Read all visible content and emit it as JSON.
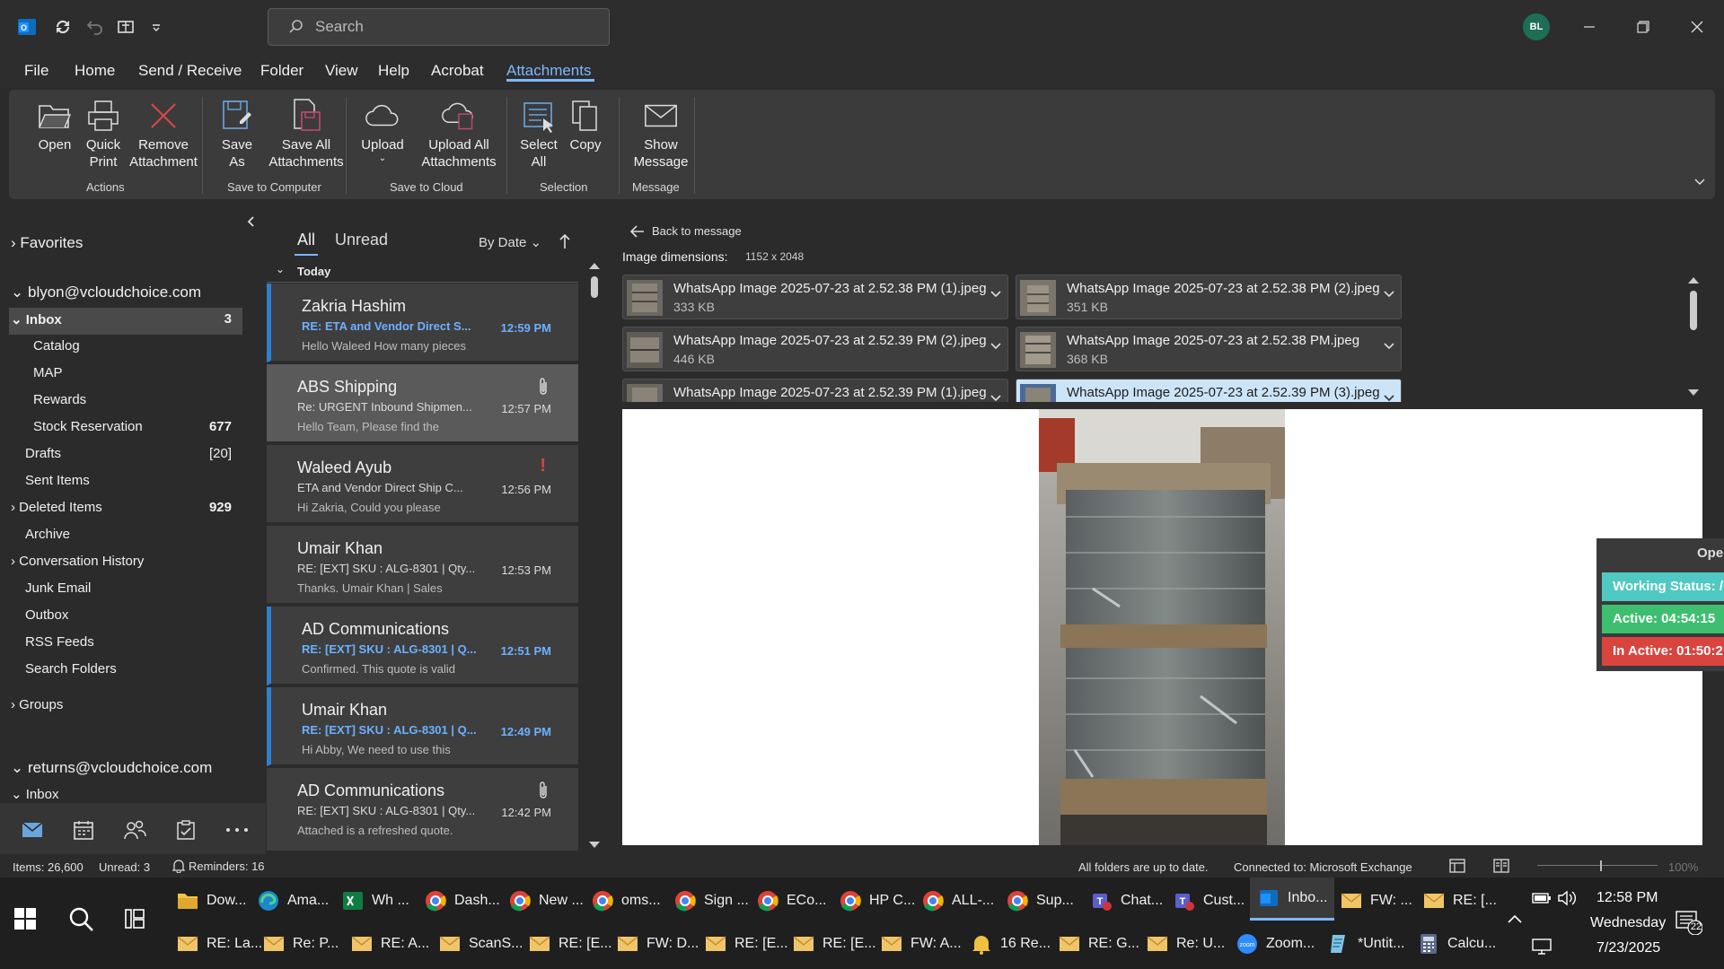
{
  "titlebar": {
    "search_placeholder": "Search",
    "avatar_initials": "BL"
  },
  "menu": {
    "items": [
      "File",
      "Home",
      "Send / Receive",
      "Folder",
      "View",
      "Help",
      "Acrobat",
      "Attachments"
    ],
    "active": "Attachments"
  },
  "ribbon": {
    "buttons": {
      "open": "Open",
      "quick_print_1": "Quick",
      "quick_print_2": "Print",
      "remove_1": "Remove",
      "remove_2": "Attachment",
      "save_as_1": "Save",
      "save_as_2": "As",
      "save_all_1": "Save All",
      "save_all_2": "Attachments",
      "upload": "Upload",
      "upload_all_1": "Upload All",
      "upload_all_2": "Attachments",
      "select_all_1": "Select",
      "select_all_2": "All",
      "copy": "Copy",
      "show_message_1": "Show",
      "show_message_2": "Message"
    },
    "groups": {
      "actions": "Actions",
      "save_to_computer": "Save to Computer",
      "save_to_cloud": "Save to Cloud",
      "selection": "Selection",
      "message": "Message"
    }
  },
  "folders": {
    "favorites": "Favorites",
    "account1": "blyon@vcloudchoice.com",
    "inbox": "Inbox",
    "inbox_count": "3",
    "catalog": "Catalog",
    "map": "MAP",
    "rewards": "Rewards",
    "stock_reservation": "Stock Reservation",
    "stock_reservation_count": "677",
    "drafts": "Drafts",
    "drafts_count": "[20]",
    "sent_items": "Sent Items",
    "deleted_items": "Deleted Items",
    "deleted_items_count": "929",
    "archive": "Archive",
    "conversation_history": "Conversation History",
    "junk_email": "Junk Email",
    "outbox": "Outbox",
    "rss_feeds": "RSS Feeds",
    "search_folders": "Search Folders",
    "groups": "Groups",
    "account2": "returns@vcloudchoice.com",
    "inbox2": "Inbox"
  },
  "msglist": {
    "filter_all": "All",
    "filter_unread": "Unread",
    "sort": "By Date",
    "group_today": "Today",
    "messages": [
      {
        "sender": "Zakria Hashim",
        "subject": "RE: ETA and Vendor Direct S...",
        "time": "12:59 PM",
        "preview": "Hello Waleed  How many pieces"
      },
      {
        "sender": "ABS Shipping",
        "subject": "Re: URGENT Inbound Shipmen...",
        "time": "12:57 PM",
        "preview": "Hello Team,  Please find the"
      },
      {
        "sender": "Waleed Ayub",
        "subject": "ETA and Vendor Direct Ship C...",
        "time": "12:56 PM",
        "preview": "Hi Zakria,  Could you please"
      },
      {
        "sender": "Umair Khan",
        "subject": "RE: [EXT] SKU : ALG-8301 | Qty...",
        "time": "12:53 PM",
        "preview": "Thanks.  Umair Khan | Sales"
      },
      {
        "sender": "AD Communications",
        "subject": "RE: [EXT] SKU : ALG-8301 | Q...",
        "time": "12:51 PM",
        "preview": "Confirmed. This quote is valid"
      },
      {
        "sender": "Umair Khan",
        "subject": "RE: [EXT] SKU : ALG-8301 | Q...",
        "time": "12:49 PM",
        "preview": "Hi Abby,  We need to use this"
      },
      {
        "sender": "AD Communications",
        "subject": "RE: [EXT] SKU : ALG-8301 | Qty...",
        "time": "12:42 PM",
        "preview": "Attached is a refreshed quote."
      }
    ]
  },
  "reading": {
    "back": "Back to message",
    "dimensions_label": "Image dimensions:",
    "dimensions_value": "1152 x 2048",
    "attachments": [
      {
        "name": "WhatsApp Image 2025-07-23 at 2.52.38 PM (1).jpeg",
        "size": "333 KB"
      },
      {
        "name": "WhatsApp Image 2025-07-23 at 2.52.38 PM (2).jpeg",
        "size": "351 KB"
      },
      {
        "name": "WhatsApp Image 2025-07-23 at 2.52.39 PM (2).jpeg",
        "size": "446 KB"
      },
      {
        "name": "WhatsApp Image 2025-07-23 at 2.52.38 PM.jpeg",
        "size": "368 KB"
      },
      {
        "name": "WhatsApp Image 2025-07-23 at 2.52.39 PM (1).jpeg",
        "size": ""
      },
      {
        "name": "WhatsApp Image 2025-07-23 at 2.52.39 PM (3).jpeg",
        "size": ""
      }
    ]
  },
  "widget": {
    "header": "Ope",
    "working": "Working Status: /",
    "active": "Active: 04:54:15",
    "inactive": "In Active: 01:50:2"
  },
  "status": {
    "items": "Items: 26,600",
    "unread": "Unread: 3",
    "reminders": "Reminders: 16",
    "uptodate": "All folders are up to date.",
    "connected": "Connected to: Microsoft Exchange",
    "zoom": "100%"
  },
  "taskbar": {
    "row1": [
      "Dow...",
      "Ama...",
      "Wh ...",
      "Dash...",
      "New ...",
      "oms...",
      "Sign ...",
      "ECo...",
      "HP C...",
      "ALL-...",
      "Sup...",
      "Chat...",
      "Cust...",
      "Inbo...",
      "FW: ...",
      "RE: [..."
    ],
    "row2": [
      "RE: La...",
      "Re: P...",
      "RE: A...",
      "ScanS...",
      "RE: [E...",
      "FW: D...",
      "RE: [E...",
      "RE: [E...",
      "FW: A...",
      "16 Re...",
      "RE: G...",
      "Re: U...",
      "Zoom...",
      "*Untit...",
      "Calcu..."
    ],
    "time": "12:58 PM",
    "day": "Wednesday",
    "date": "7/23/2025",
    "notif_count": "22"
  },
  "colors": {
    "accent": "#7db7ff",
    "unread_blue": "#2f7fcf",
    "avatar": "#1e6e55",
    "widget_teal": "#4fc9c2",
    "widget_green": "#3dbf6f",
    "widget_red": "#d9443f"
  }
}
